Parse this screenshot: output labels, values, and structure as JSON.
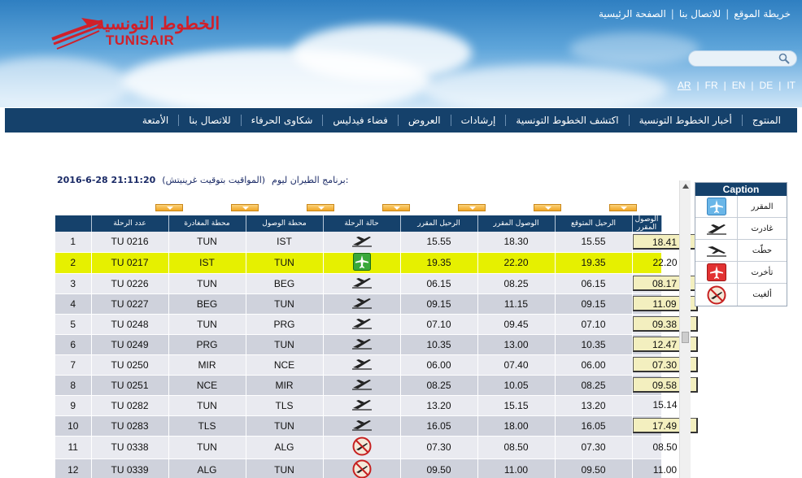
{
  "header": {
    "logo_arabic": "الخطوط التونسية",
    "logo_english": "TUNISAIR",
    "top_links": [
      "خريطة الموقع",
      "للاتصال بنا",
      "الصفحة الرئيسية"
    ],
    "languages": [
      "AR",
      "FR",
      "EN",
      "DE",
      "IT"
    ]
  },
  "nav": {
    "items": [
      "المنتوج",
      "أخبار الخطوط التونسية",
      "اكتشف الخطوط التونسية",
      "إرشادات",
      "العروض",
      "فضاء فيدليس",
      "شكاوى الحرفاء",
      "للاتصال بنا",
      "الأمتعة"
    ]
  },
  "schedule": {
    "label": "برنامج الطيران ليوم:",
    "note": "(المواقيت بتوقيت غرينيتش)",
    "datetime": "2016-6-28 21:11:20"
  },
  "table": {
    "headers": [
      "عدد الرحلة",
      "محطة المغادرة",
      "محطة الوصول",
      "حالة الرحلة",
      "الرحيل المقرر",
      "الوصول المقرر",
      "الرحيل المتوقع",
      "الوصول المقرر"
    ],
    "rows": [
      {
        "index": "1",
        "flight": "TU 0216",
        "from": "TUN",
        "to": "IST",
        "status": "departed",
        "sched_dep": "15.55",
        "sched_arr": "18.30",
        "exp_dep": "15.55",
        "arr": "18.41",
        "arr_boxed": true
      },
      {
        "index": "2",
        "flight": "TU 0217",
        "from": "IST",
        "to": "TUN",
        "status": "scheduled",
        "sched_dep": "19.35",
        "sched_arr": "22.20",
        "exp_dep": "19.35",
        "arr": "22.20",
        "arr_boxed": false
      },
      {
        "index": "3",
        "flight": "TU 0226",
        "from": "TUN",
        "to": "BEG",
        "status": "departed",
        "sched_dep": "06.15",
        "sched_arr": "08.25",
        "exp_dep": "06.15",
        "arr": "08.17",
        "arr_boxed": true
      },
      {
        "index": "4",
        "flight": "TU 0227",
        "from": "BEG",
        "to": "TUN",
        "status": "departed",
        "sched_dep": "09.15",
        "sched_arr": "11.15",
        "exp_dep": "09.15",
        "arr": "11.09",
        "arr_boxed": true
      },
      {
        "index": "5",
        "flight": "TU 0248",
        "from": "TUN",
        "to": "PRG",
        "status": "departed",
        "sched_dep": "07.10",
        "sched_arr": "09.45",
        "exp_dep": "07.10",
        "arr": "09.38",
        "arr_boxed": true
      },
      {
        "index": "6",
        "flight": "TU 0249",
        "from": "PRG",
        "to": "TUN",
        "status": "departed",
        "sched_dep": "10.35",
        "sched_arr": "13.00",
        "exp_dep": "10.35",
        "arr": "12.47",
        "arr_boxed": true
      },
      {
        "index": "7",
        "flight": "TU 0250",
        "from": "MIR",
        "to": "NCE",
        "status": "departed",
        "sched_dep": "06.00",
        "sched_arr": "07.40",
        "exp_dep": "06.00",
        "arr": "07.30",
        "arr_boxed": true
      },
      {
        "index": "8",
        "flight": "TU 0251",
        "from": "NCE",
        "to": "MIR",
        "status": "departed",
        "sched_dep": "08.25",
        "sched_arr": "10.05",
        "exp_dep": "08.25",
        "arr": "09.58",
        "arr_boxed": true
      },
      {
        "index": "9",
        "flight": "TU 0282",
        "from": "TUN",
        "to": "TLS",
        "status": "departed",
        "sched_dep": "13.20",
        "sched_arr": "15.15",
        "exp_dep": "13.20",
        "arr": "15.14",
        "arr_boxed": false
      },
      {
        "index": "10",
        "flight": "TU 0283",
        "from": "TLS",
        "to": "TUN",
        "status": "departed",
        "sched_dep": "16.05",
        "sched_arr": "18.00",
        "exp_dep": "16.05",
        "arr": "17.49",
        "arr_boxed": true
      },
      {
        "index": "11",
        "flight": "TU 0338",
        "from": "TUN",
        "to": "ALG",
        "status": "cancelled",
        "sched_dep": "07.30",
        "sched_arr": "08.50",
        "exp_dep": "07.30",
        "arr": "08.50",
        "arr_boxed": false
      },
      {
        "index": "12",
        "flight": "TU 0339",
        "from": "ALG",
        "to": "TUN",
        "status": "cancelled",
        "sched_dep": "09.50",
        "sched_arr": "11.00",
        "exp_dep": "09.50",
        "arr": "11.00",
        "arr_boxed": false
      }
    ]
  },
  "caption": {
    "title": "Caption",
    "items": [
      {
        "label": "المقرر",
        "icon": "scheduled"
      },
      {
        "label": "غادرت",
        "icon": "departed"
      },
      {
        "label": "حطّت",
        "icon": "landed"
      },
      {
        "label": "تأخرت",
        "icon": "delayed"
      },
      {
        "label": "ألغيت",
        "icon": "cancelled"
      }
    ]
  },
  "colors": {
    "nav_bg": "#15416b",
    "highlight_row": "#e6f000",
    "arrival_box": "#f3efbf",
    "brand_red": "#d0202a"
  }
}
